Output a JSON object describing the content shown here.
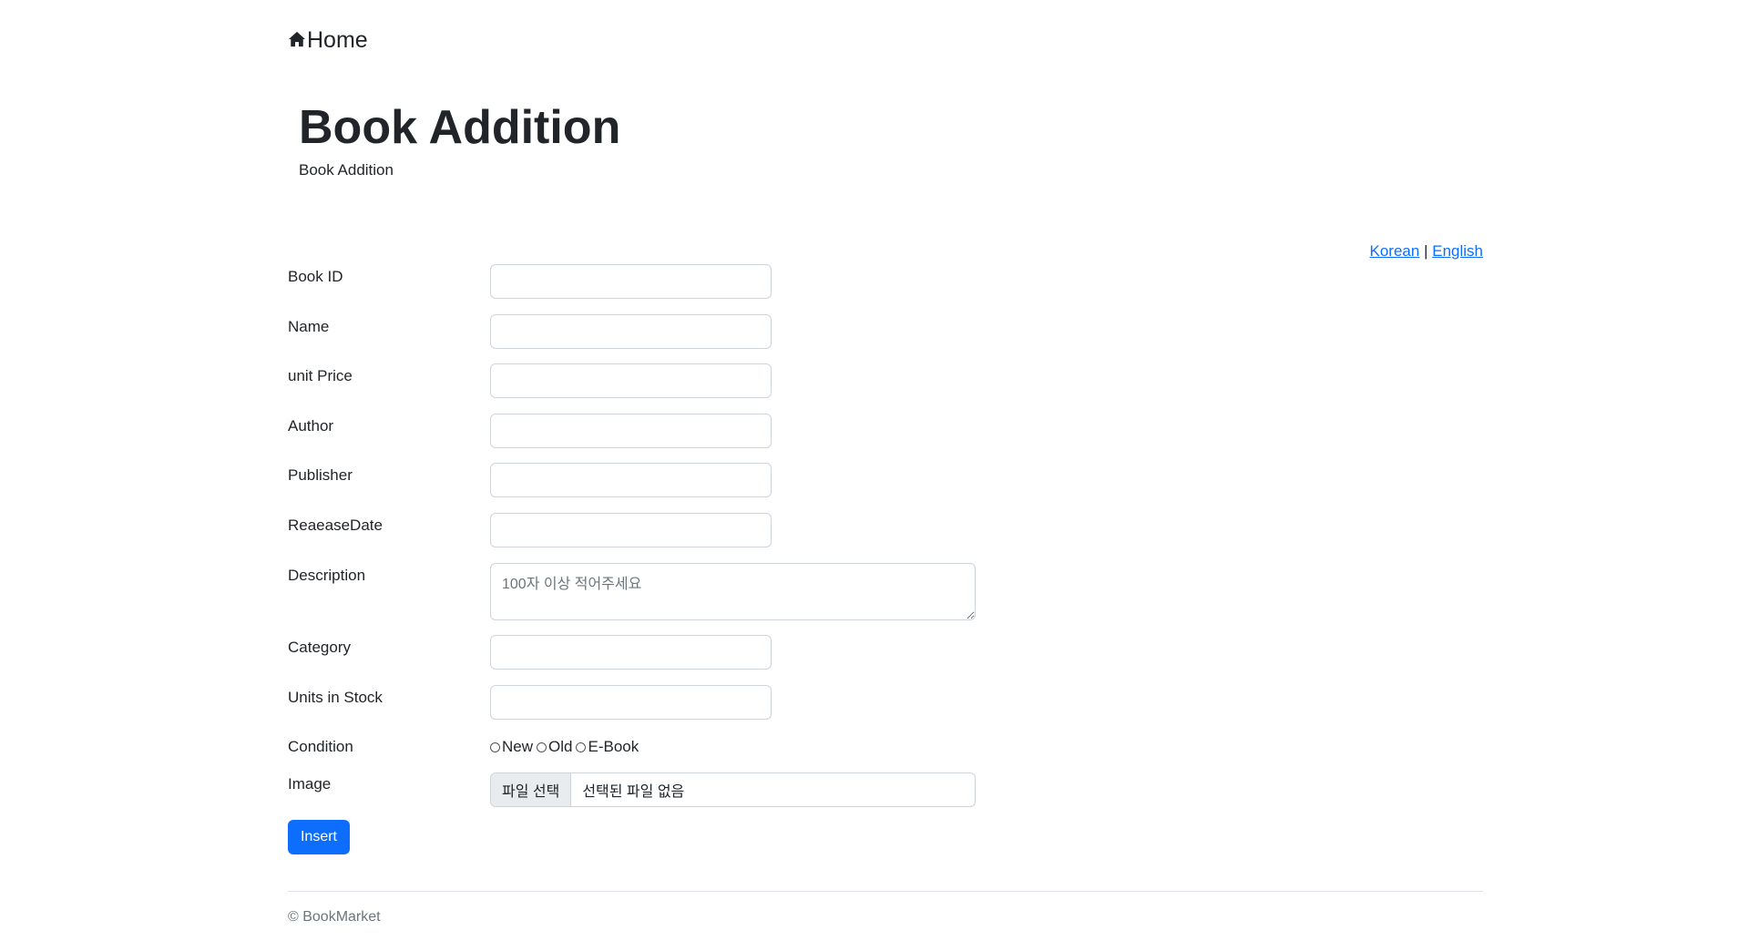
{
  "nav": {
    "home_icon": "home-icon",
    "home_label": "Home"
  },
  "header": {
    "title": "Book Addition",
    "subtitle": "Book Addition"
  },
  "language": {
    "korean": "Korean",
    "separator": "|",
    "english": "English"
  },
  "form": {
    "book_id_label": "Book ID",
    "name_label": "Name",
    "unit_price_label": "unit Price",
    "author_label": "Author",
    "publisher_label": "Publisher",
    "release_date_label": "ReaeaseDate",
    "description_label": "Description",
    "description_placeholder": "100자 이상 적어주세요",
    "category_label": "Category",
    "units_in_stock_label": "Units in Stock",
    "condition_label": "Condition",
    "condition_options": [
      "New",
      "Old",
      "E-Book"
    ],
    "image_label": "Image",
    "file_button_label": "파일 선택",
    "file_status": "선택된 파일 없음",
    "submit_label": "Insert"
  },
  "footer": {
    "copyright": "© BookMarket"
  },
  "colors": {
    "primary": "#0d6efd",
    "text": "#212529",
    "muted": "#6c757d",
    "border": "#ced4da"
  }
}
